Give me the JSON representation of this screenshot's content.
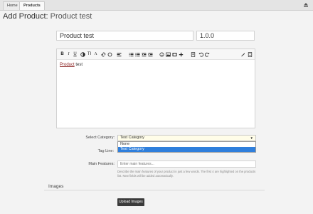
{
  "nav": {
    "tabs": [
      {
        "label": "Home"
      },
      {
        "label": "Products"
      }
    ]
  },
  "page": {
    "title": "Add Product:",
    "subtitle": "Product test"
  },
  "form": {
    "name_value": "Product test",
    "version_value": "1.0.0",
    "editor": {
      "body_link": "Product",
      "body_text": " test"
    },
    "category": {
      "label": "Select Category:",
      "selected": "Test Category",
      "options": [
        "None",
        "Test Category"
      ],
      "highlighted_index": 1
    },
    "tagline": {
      "label": "Tag Line:"
    },
    "features": {
      "label": "Main Features:",
      "placeholder": "Enter main features...",
      "help": "Describe the main features of your product in just a few words. The first 4 are highlighted on the products list. New fields will be added automatically."
    }
  },
  "images": {
    "title": "Images",
    "upload_label": "Upload Images"
  },
  "colors": {
    "accent": "#2f7fdc",
    "button": "#3a3a3a",
    "link": "#8b2222"
  }
}
